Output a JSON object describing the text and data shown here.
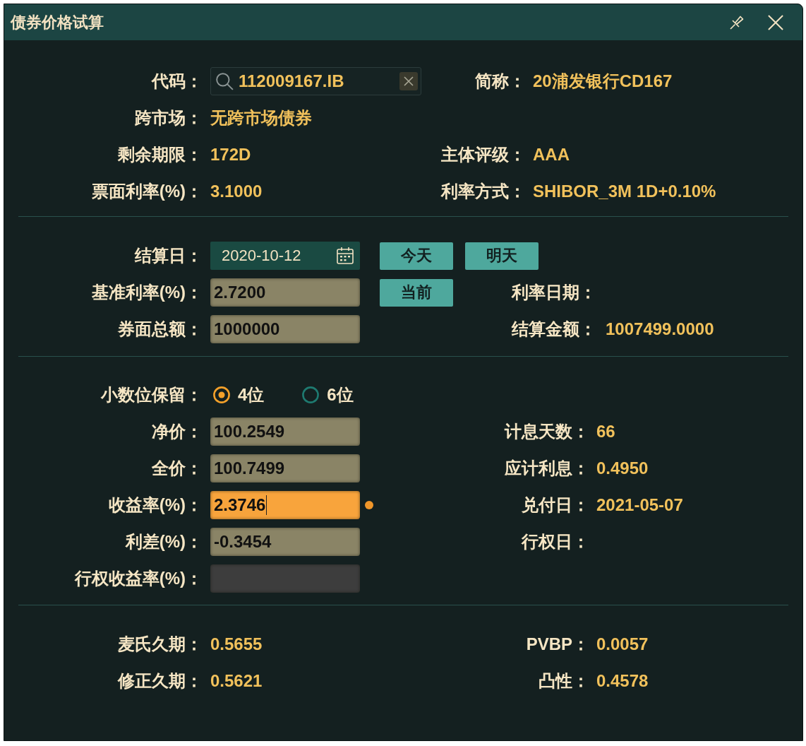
{
  "window": {
    "title": "债券价格试算"
  },
  "bond_info": [
    {
      "left": {
        "label": "代码：",
        "kind": "search",
        "value": "112009167.IB"
      },
      "right": {
        "label": "简称：",
        "value": "20浦发银行CD167"
      }
    },
    {
      "left": {
        "label": "跨市场：",
        "kind": "text",
        "value": "无跨市场债券"
      }
    },
    {
      "left": {
        "label": "剩余期限：",
        "kind": "text",
        "value": "172D"
      },
      "right": {
        "label": "主体评级：",
        "value": "AAA"
      }
    },
    {
      "left": {
        "label": "票面利率(%)：",
        "kind": "text",
        "value": "3.1000"
      },
      "right": {
        "label": "利率方式：",
        "value": "SHIBOR_3M 1D+0.10%"
      }
    }
  ],
  "settlement": [
    {
      "label": "结算日：",
      "field": {
        "kind": "date",
        "value": "2020-10-12",
        "focused": false,
        "disabled": false
      },
      "buttons": [
        "今天",
        "明天"
      ]
    },
    {
      "label": "基准利率(%)：",
      "field": {
        "kind": "input",
        "value": "2.7200",
        "focused": false,
        "disabled": false
      },
      "buttons": [
        "当前"
      ],
      "right": {
        "label": "利率日期："
      }
    },
    {
      "label": "券面总额：",
      "field": {
        "kind": "input",
        "value": "1000000",
        "focused": false,
        "disabled": false
      },
      "right": {
        "label": "结算金额：",
        "value": "1007499.0000"
      }
    }
  ],
  "pricing": {
    "decimal_places": {
      "label": "小数位保留：",
      "options": [
        {
          "label": "4位",
          "selected": true
        },
        {
          "label": "6位",
          "selected": false
        }
      ]
    },
    "rows": [
      {
        "label": "净价：",
        "field": {
          "kind": "input",
          "value": "100.2549",
          "focused": false,
          "disabled": false
        },
        "right": {
          "label": "计息天数：",
          "value": "66"
        }
      },
      {
        "label": "全价：",
        "field": {
          "kind": "input",
          "value": "100.7499",
          "focused": false,
          "disabled": false
        },
        "right": {
          "label": "应计利息：",
          "value": "0.4950"
        }
      },
      {
        "label": "收益率(%)：",
        "field": {
          "kind": "input",
          "value": "2.3746",
          "focused": true,
          "disabled": false
        },
        "right": {
          "label": "兑付日：",
          "value": "2021-05-07"
        }
      },
      {
        "label": "利差(%)：",
        "field": {
          "kind": "input",
          "value": "-0.3454",
          "focused": false,
          "disabled": false
        },
        "right": {
          "label": "行权日："
        }
      },
      {
        "label": "行权收益率(%)：",
        "field": {
          "kind": "input",
          "focused": false,
          "disabled": true
        }
      }
    ]
  },
  "risk_metrics": [
    {
      "left": {
        "label": "麦氏久期：",
        "value": "0.5655"
      },
      "right": {
        "label": "PVBP：",
        "value": "0.0057"
      }
    },
    {
      "left": {
        "label": "修正久期：",
        "value": "0.5621"
      },
      "right": {
        "label": "凸性：",
        "value": "0.4578"
      }
    }
  ]
}
